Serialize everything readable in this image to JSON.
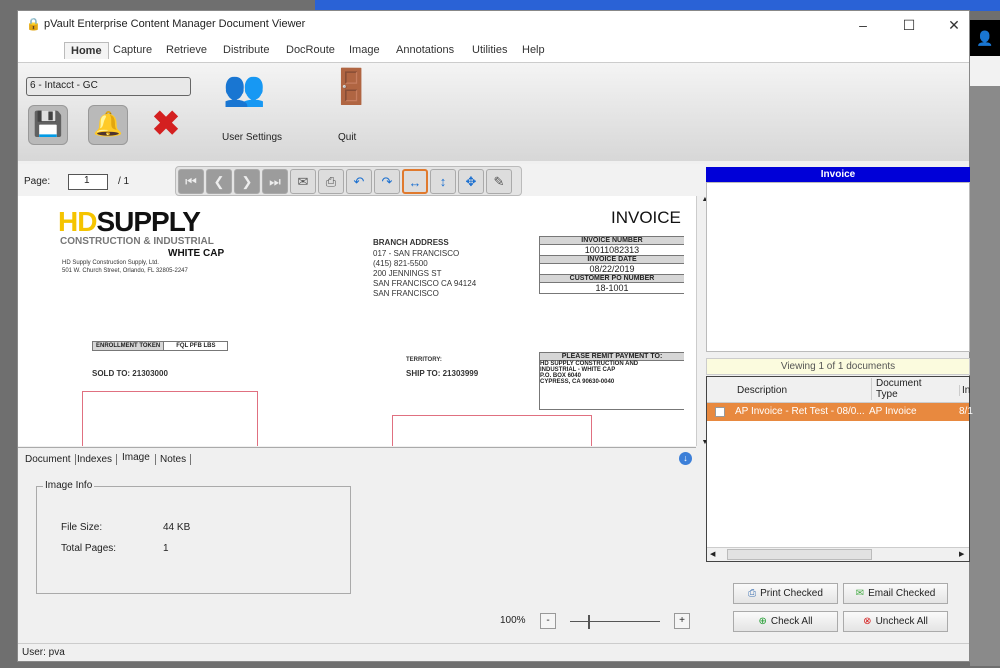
{
  "window": {
    "title": "pVault Enterprise Content Manager Document Viewer",
    "minimize": "–",
    "maximize": "☐",
    "close": "✕"
  },
  "menu": [
    "Home",
    "Capture",
    "Retrieve",
    "Distribute",
    "DocRoute",
    "Image",
    "Annotations",
    "Utilities",
    "Help"
  ],
  "ribbon": {
    "combo_value": "6 - Intacct - GC",
    "user_settings": "User Settings",
    "quit": "Quit"
  },
  "viewer": {
    "page_label": "Page:",
    "page_value": "1",
    "page_total": "/ 1"
  },
  "invoice": {
    "logo": "HDSUPPLY",
    "division": "CONSTRUCTION & INDUSTRIAL",
    "brand": "WHITE CAP",
    "company_lines": [
      "HD Supply Construction Supply, Ltd.",
      "501 W. Church Street,  Orlando, FL 32805-2247"
    ],
    "title": "INVOICE",
    "branch_label": "BRANCH ADDRESS",
    "branch_lines": [
      "017 - SAN FRANCISCO",
      "(415) 821-5500",
      "200 JENNINGS ST",
      "SAN FRANCISCO CA 94124",
      "SAN FRANCISCO"
    ],
    "invoice_number_label": "INVOICE NUMBER",
    "invoice_number": "10011082313",
    "invoice_date_label": "INVOICE DATE",
    "invoice_date": "08/22/2019",
    "po_label": "CUSTOMER PO NUMBER",
    "po": "18-1001",
    "enrollment_label": "ENROLLMENT TOKEN",
    "enrollment_value": "FQL PFB LBS",
    "sold_to": "SOLD TO:  21303000",
    "territory": "TERRITORY:",
    "ship_to": "SHIP TO:  21303999",
    "remit_label": "PLEASE REMIT PAYMENT TO:",
    "remit_lines": [
      "HD SUPPLY CONSTRUCTION AND",
      "INDUSTRIAL - WHITE CAP",
      "P.O. BOX 6040",
      "CYPRESS, CA 90630-0040"
    ]
  },
  "bottom_tabs": [
    "Document",
    "Indexes",
    "Image",
    "Notes"
  ],
  "image_info": {
    "legend": "Image Info",
    "file_size_label": "File Size:",
    "file_size": "44 KB",
    "total_pages_label": "Total Pages:",
    "total_pages": "1"
  },
  "zoom": {
    "value": "100%",
    "minus": "-",
    "plus": "+",
    "level": 0.1
  },
  "status": "User: pva",
  "right": {
    "header": "Invoice",
    "viewing": "Viewing 1 of 1 documents",
    "columns": [
      "Description",
      "Document Type",
      "In"
    ],
    "rows": [
      {
        "description": "AP Invoice - Ret Test - 08/0...",
        "type": "AP Invoice",
        "extra": "8/1"
      }
    ],
    "buttons": {
      "print": "Print Checked",
      "email": "Email Checked",
      "check_all": "Check All",
      "uncheck_all": "Uncheck All"
    }
  },
  "colors": {
    "selected_row": "#e8893f",
    "header_blue": "#0000d8",
    "accent": "#e07a2e"
  }
}
